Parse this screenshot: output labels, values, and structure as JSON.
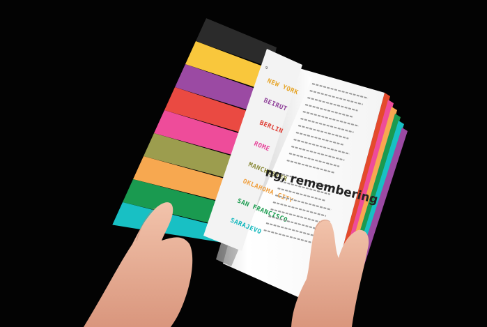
{
  "scene": {
    "background": "#030303",
    "booklet": {
      "stripe_colors": [
        "#2b2b2b",
        "#f9c73c",
        "#9b4aa3",
        "#ea4a42",
        "#ee4c9a",
        "#9c9d4e",
        "#f7a850",
        "#1a9a50",
        "#18c0c4"
      ],
      "edge_colors": [
        "#e44a2c",
        "#ee4c9a",
        "#f7a850",
        "#1a9a50",
        "#18c0c4",
        "#9b4aa3"
      ],
      "page_number": "9",
      "heading": "ng, remembering",
      "cities": [
        {
          "name": "NEW YORK",
          "color": "#e6a528"
        },
        {
          "name": "BEIRUT",
          "color": "#8e3f98"
        },
        {
          "name": "BERLIN",
          "color": "#de3c33"
        },
        {
          "name": "ROME",
          "color": "#e6439a"
        },
        {
          "name": "MANCHESTER",
          "color": "#8b8b3a"
        },
        {
          "name": "OKLAHOMA CITY",
          "color": "#f0a040"
        },
        {
          "name": "SAN FRANCISCO",
          "color": "#179a4c"
        },
        {
          "name": "SARAJEVO",
          "color": "#13b8bd"
        }
      ]
    }
  }
}
